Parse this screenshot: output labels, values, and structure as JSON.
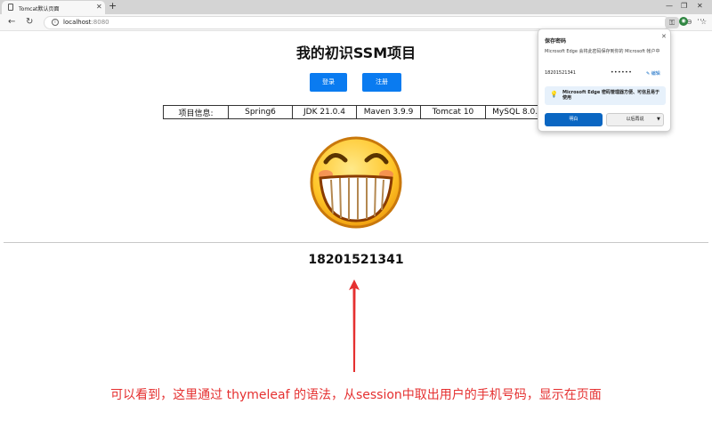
{
  "browser": {
    "tab_title": "Tomcat默认页面",
    "url_host": "localhost",
    "url_port": ":8080"
  },
  "page": {
    "title": "我的初识SSM项目",
    "login_label": "登录",
    "register_label": "注册",
    "info_cells": [
      "项目信息:",
      "Spring6",
      "JDK 21.0.4",
      "Maven 3.9.9",
      "Tomcat 10",
      "MySQL 8.0.4"
    ],
    "phone": "18201521341"
  },
  "annotation": "可以看到，这里通过 thymeleaf 的语法，从session中取出用户的手机号码，显示在页面",
  "password_popup": {
    "title": "保存密码",
    "description": "Microsoft Edge 会将此密码保存到你的 Microsoft 帐户中",
    "username": "18201521341",
    "password_mask": "••••••",
    "edit_label": "编辑",
    "tip": "Microsoft Edge 密码管理器方便、可信且易于使用",
    "save_label": "明白",
    "later_label": "以后再说"
  },
  "colors": {
    "accent": "#0a7bf0",
    "annotation": "#e53030"
  }
}
